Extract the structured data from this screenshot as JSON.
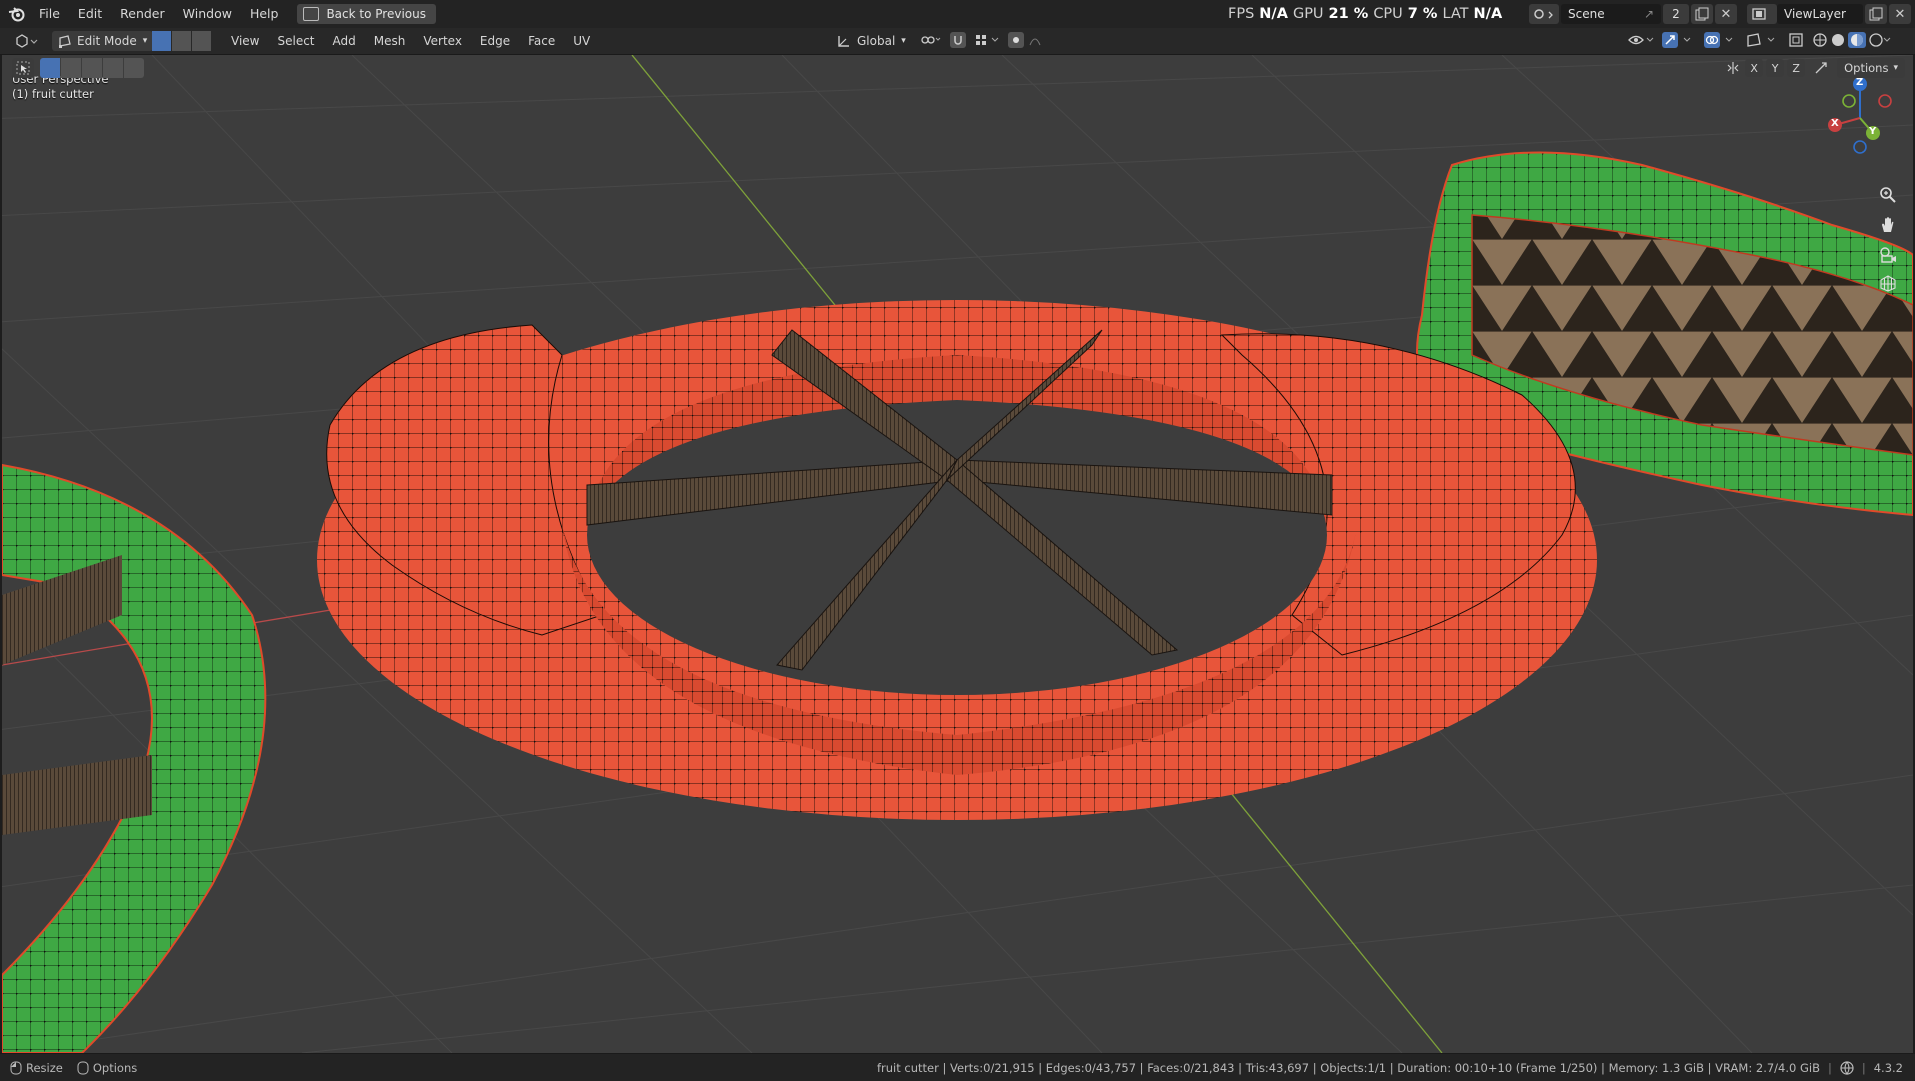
{
  "menu": {
    "items": [
      "File",
      "Edit",
      "Render",
      "Window",
      "Help"
    ],
    "back_button": "Back to Previous"
  },
  "perf": {
    "fps_label": "FPS",
    "fps_value": "N/A",
    "gpu_label": "GPU",
    "gpu_value": "21 %",
    "cpu_label": "CPU",
    "cpu_value": "7 %",
    "lat_label": "LAT",
    "lat_value": "N/A"
  },
  "scene": {
    "name": "Scene",
    "users": "2",
    "view_layer": "ViewLayer"
  },
  "toolbar": {
    "mode": "Edit Mode",
    "menus": [
      "View",
      "Select",
      "Add",
      "Mesh",
      "Vertex",
      "Edge",
      "Face",
      "UV"
    ],
    "orientation": "Global",
    "options": "Options",
    "axes": [
      "X",
      "Y",
      "Z"
    ]
  },
  "viewport": {
    "perspective": "User Perspective",
    "object": "(1) fruit cutter",
    "gizmo_axes": {
      "x": "X",
      "y": "Y",
      "z": "Z"
    },
    "colors": {
      "background": "#3d3d3d",
      "selected_mesh": "#e8553a",
      "unselected_mesh": "#3fa844",
      "blades": "#4a3f33",
      "x_axis": "#b84a4a",
      "y_axis": "#7ea13a"
    }
  },
  "status": {
    "resize": "Resize",
    "options": "Options",
    "stats": "fruit cutter | Verts:0/21,915 | Edges:0/43,757 | Faces:0/21,843 | Tris:43,697 | Objects:1/1 | Duration: 00:10+10 (Frame 1/250) | Memory: 1.3 GiB | VRAM: 2.7/4.0 GiB",
    "version": "4.3.2"
  }
}
